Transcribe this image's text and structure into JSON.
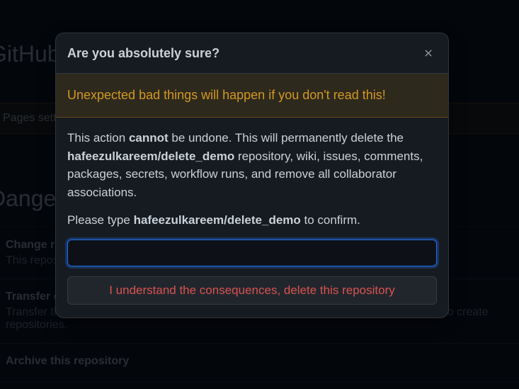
{
  "background": {
    "brand": "GitHub",
    "pages_settings": "Pages settings",
    "danger_zone": "Danger Zone",
    "items": [
      {
        "title": "Change repository visibility",
        "desc": "This repository is currently public."
      },
      {
        "title": "Transfer ownership",
        "desc": "Transfer this repository to another user or to an organization where you have the ability to create repositories."
      },
      {
        "title": "Archive this repository",
        "desc": ""
      }
    ]
  },
  "dialog": {
    "title": "Are you absolutely sure?",
    "flash_warning": "Unexpected bad things will happen if you don't read this!",
    "body": {
      "action_prefix": "This action ",
      "cannot": "cannot",
      "action_mid": " be undone. This will permanently delete the ",
      "repo_name": "hafeezulkareem/delete_demo",
      "action_suffix": " repository, wiki, issues, comments, packages, secrets, workflow runs, and remove all collaborator associations.",
      "confirm_prefix": "Please type ",
      "confirm_repo": "hafeezulkareem/delete_demo",
      "confirm_suffix": " to confirm."
    },
    "input_value": "",
    "button_label": "I understand the consequences, delete this repository"
  }
}
